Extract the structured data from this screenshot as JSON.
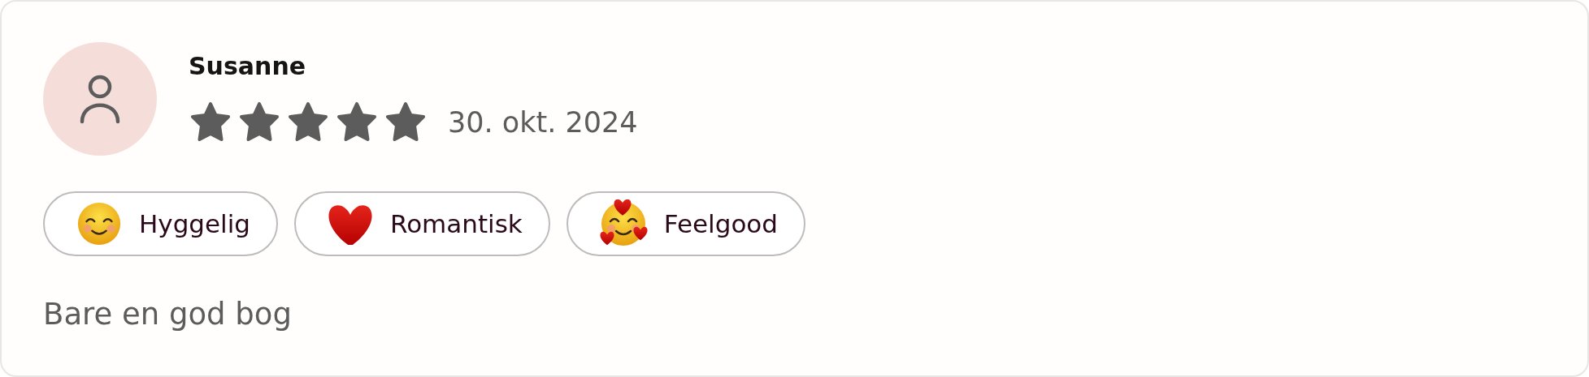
{
  "review": {
    "author": "Susanne",
    "stars": 5,
    "date": "30. okt. 2024",
    "tags": [
      {
        "kind": "smiling",
        "label": "Hyggelig"
      },
      {
        "kind": "heart",
        "label": "Romantisk"
      },
      {
        "kind": "hearts-face",
        "label": "Feelgood"
      }
    ],
    "text": "Bare en god bog"
  }
}
